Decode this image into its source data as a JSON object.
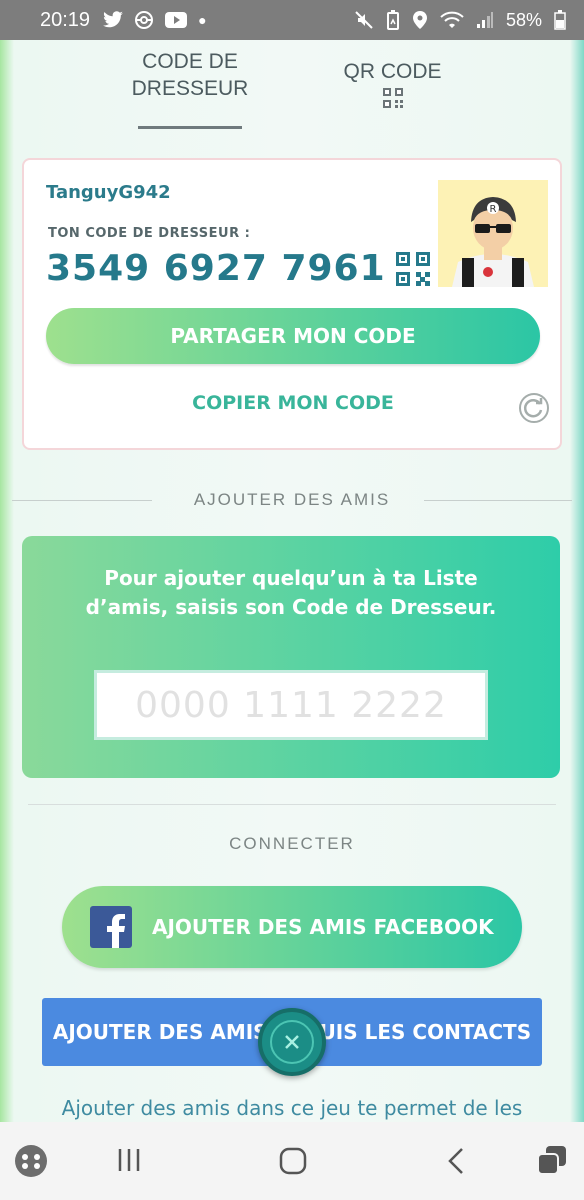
{
  "status_bar": {
    "time": "20:19",
    "battery": "58%"
  },
  "tabs": {
    "code_line1": "CODE DE",
    "code_line2": "DRESSEUR",
    "qr": "QR CODE"
  },
  "trainer_card": {
    "name": "TanguyG942",
    "code_label": "TON CODE DE DRESSEUR :",
    "code_value": "3549 6927 7961",
    "share_button": "PARTAGER MON CODE",
    "copy_link": "COPIER MON CODE"
  },
  "add_friends": {
    "section_title": "AJOUTER DES AMIS",
    "instructions": "Pour ajouter quelqu’un à ta Liste d’amis, saisis son Code de Dresseur.",
    "input_placeholder": "0000 1111 2222",
    "input_value": ""
  },
  "connect": {
    "section_title": "CONNECTER",
    "facebook_button": "AJOUTER DES AMIS FACEBOOK",
    "contacts_button_left": "AJOUTER DES AMIS",
    "contacts_button_right": "UIS LES CONTACTS",
    "footer_text": "Ajouter des amis dans ce jeu te permet de les"
  },
  "colors": {
    "accent_green": "#2bc6a5",
    "trainer_text": "#25798b",
    "contacts_blue": "#4b8ae0"
  }
}
